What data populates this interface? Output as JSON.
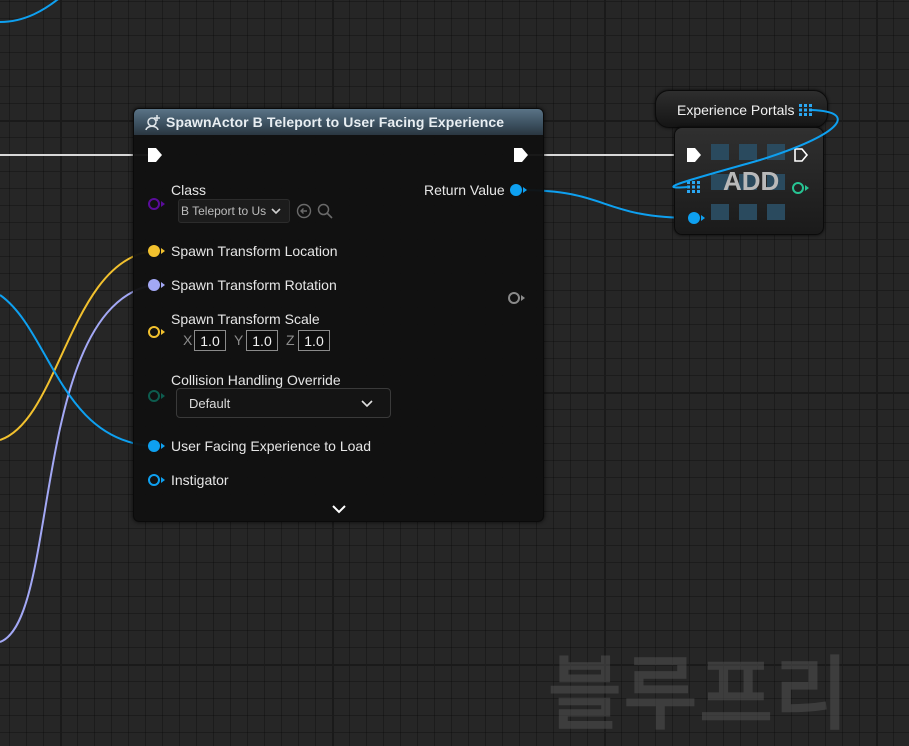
{
  "spawn_node": {
    "title": "SpawnActor B Teleport to User Facing Experience",
    "class_label": "Class",
    "class_value": "B Teleport to Us",
    "return_value_label": "Return Value",
    "location_label": "Spawn Transform Location",
    "rotation_label": "Spawn Transform Rotation",
    "scale_label": "Spawn Transform Scale",
    "scale_x_label": "X",
    "scale_y_label": "Y",
    "scale_z_label": "Z",
    "scale_x": "1.0",
    "scale_y": "1.0",
    "scale_z": "1.0",
    "collision_label": "Collision Handling Override",
    "collision_value": "Default",
    "ufe_label": "User Facing Experience to Load",
    "instigator_label": "Instigator"
  },
  "portals_node": {
    "label": "Experience Portals"
  },
  "add_node": {
    "label": "ADD"
  },
  "watermark": "블루프리",
  "colors": {
    "exec": "#ffffff",
    "object": "#0ea0f0",
    "class": "#5a0c9a",
    "vector": "#f2c12e",
    "rotator": "#a3a8f5",
    "collision": "#0d5c4e",
    "wildcard": "#8a8a8a"
  }
}
